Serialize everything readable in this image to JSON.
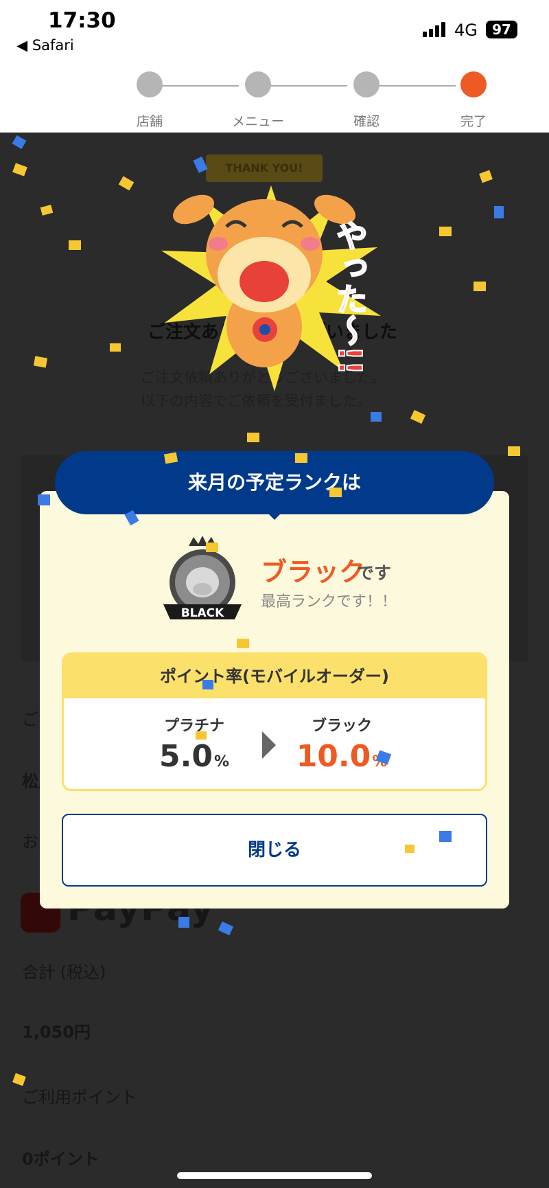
{
  "status": {
    "time": "17:30",
    "back_app": "◀ Safari",
    "network": "4G",
    "battery": "97"
  },
  "steps": [
    {
      "label": "店舗",
      "active": false
    },
    {
      "label": "メニュー",
      "active": false
    },
    {
      "label": "確認",
      "active": false
    },
    {
      "label": "完了",
      "active": true
    }
  ],
  "background": {
    "title": "ご注文ありがとうございました",
    "message": "ご注文依頼ありがとうございました。\n以下の内容でご依頼を受付ました。",
    "payment_label": "お支払い方法",
    "store_label": "ご注文店舗",
    "store_name": "松屋",
    "paypay": "PayPay",
    "total_label": "合計 (税込)",
    "total_value": "1,050円",
    "points_label": "ご利用ポイント",
    "points_value": "0ポイント"
  },
  "celebration": {
    "banner": "THANK YOU!",
    "shout": "やった〜!!"
  },
  "modal": {
    "title": "来月の予定ランクは",
    "rank_name": "ブラック",
    "rank_suffix": "です",
    "rank_sub": "最高ランクです！！",
    "badge_text": "BLACK",
    "rate_title": "ポイント率(モバイルオーダー)",
    "from_label": "プラチナ",
    "from_value": "5.0",
    "to_label": "ブラック",
    "to_value": "10.0",
    "unit": "%",
    "close_label": "閉じる"
  },
  "colors": {
    "accent": "#ee5a24",
    "navy": "#013a8a",
    "yellow": "#fbe06c",
    "modal_bg": "#fdf9dc"
  }
}
